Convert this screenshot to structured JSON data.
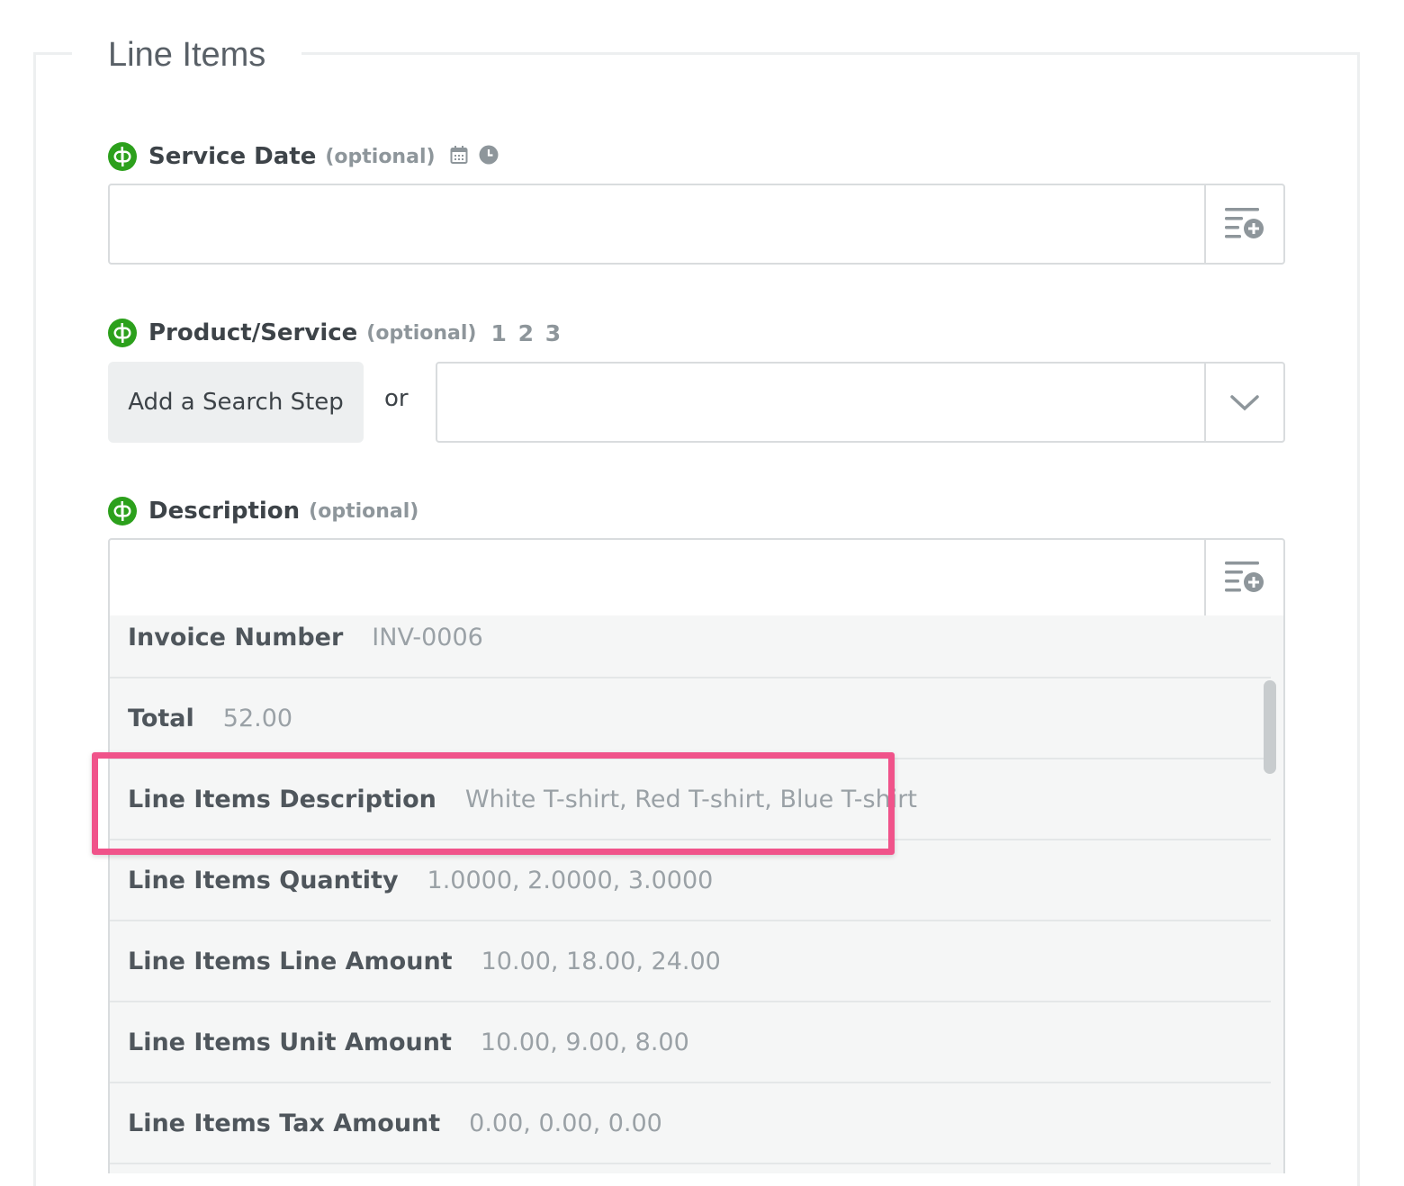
{
  "section": {
    "legend": "Line Items"
  },
  "service_date": {
    "label": "Service Date",
    "optional": "(optional)",
    "icons": [
      "calendar-icon",
      "clock-icon"
    ]
  },
  "product_service": {
    "label": "Product/Service",
    "optional": "(optional)",
    "step_numbers": "1 2 3",
    "search_button": "Add a Search Step",
    "or_text": "or"
  },
  "description": {
    "label": "Description",
    "optional": "(optional)"
  },
  "dropdown": {
    "rows": [
      {
        "key": "Invoice Number",
        "value": "INV-0006"
      },
      {
        "key": "Total",
        "value": "52.00"
      },
      {
        "key": "Line Items Description",
        "value": "White T-shirt, Red T-shirt, Blue T-shirt"
      },
      {
        "key": "Line Items Quantity",
        "value": "1.0000, 2.0000, 3.0000"
      },
      {
        "key": "Line Items Line Amount",
        "value": "10.00, 18.00, 24.00"
      },
      {
        "key": "Line Items Unit Amount",
        "value": "10.00, 9.00, 8.00"
      },
      {
        "key": "Line Items Tax Amount",
        "value": "0.00, 0.00, 0.00"
      }
    ],
    "highlighted_row": "Line Items Description"
  },
  "colors": {
    "quickbooks_green": "#2ca01c",
    "highlight": "#f0538a"
  }
}
